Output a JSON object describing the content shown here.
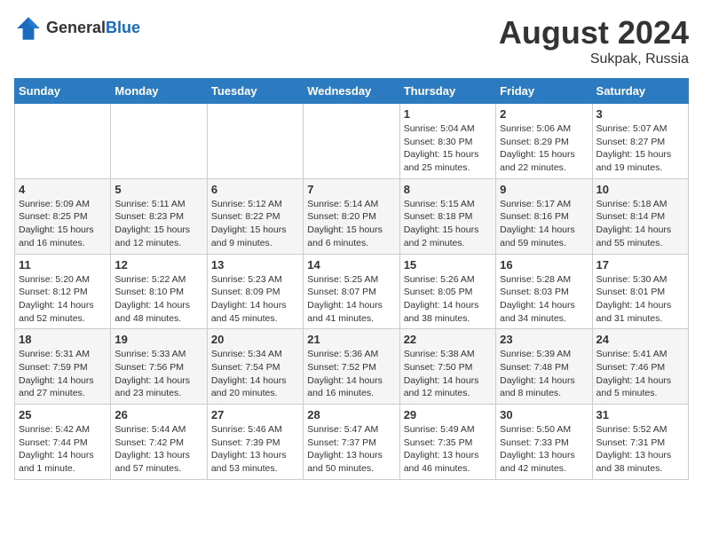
{
  "header": {
    "logo_general": "General",
    "logo_blue": "Blue",
    "month_year": "August 2024",
    "location": "Sukpak, Russia"
  },
  "weekdays": [
    "Sunday",
    "Monday",
    "Tuesday",
    "Wednesday",
    "Thursday",
    "Friday",
    "Saturday"
  ],
  "weeks": [
    [
      {
        "day": "",
        "info": ""
      },
      {
        "day": "",
        "info": ""
      },
      {
        "day": "",
        "info": ""
      },
      {
        "day": "",
        "info": ""
      },
      {
        "day": "1",
        "info": "Sunrise: 5:04 AM\nSunset: 8:30 PM\nDaylight: 15 hours\nand 25 minutes."
      },
      {
        "day": "2",
        "info": "Sunrise: 5:06 AM\nSunset: 8:29 PM\nDaylight: 15 hours\nand 22 minutes."
      },
      {
        "day": "3",
        "info": "Sunrise: 5:07 AM\nSunset: 8:27 PM\nDaylight: 15 hours\nand 19 minutes."
      }
    ],
    [
      {
        "day": "4",
        "info": "Sunrise: 5:09 AM\nSunset: 8:25 PM\nDaylight: 15 hours\nand 16 minutes."
      },
      {
        "day": "5",
        "info": "Sunrise: 5:11 AM\nSunset: 8:23 PM\nDaylight: 15 hours\nand 12 minutes."
      },
      {
        "day": "6",
        "info": "Sunrise: 5:12 AM\nSunset: 8:22 PM\nDaylight: 15 hours\nand 9 minutes."
      },
      {
        "day": "7",
        "info": "Sunrise: 5:14 AM\nSunset: 8:20 PM\nDaylight: 15 hours\nand 6 minutes."
      },
      {
        "day": "8",
        "info": "Sunrise: 5:15 AM\nSunset: 8:18 PM\nDaylight: 15 hours\nand 2 minutes."
      },
      {
        "day": "9",
        "info": "Sunrise: 5:17 AM\nSunset: 8:16 PM\nDaylight: 14 hours\nand 59 minutes."
      },
      {
        "day": "10",
        "info": "Sunrise: 5:18 AM\nSunset: 8:14 PM\nDaylight: 14 hours\nand 55 minutes."
      }
    ],
    [
      {
        "day": "11",
        "info": "Sunrise: 5:20 AM\nSunset: 8:12 PM\nDaylight: 14 hours\nand 52 minutes."
      },
      {
        "day": "12",
        "info": "Sunrise: 5:22 AM\nSunset: 8:10 PM\nDaylight: 14 hours\nand 48 minutes."
      },
      {
        "day": "13",
        "info": "Sunrise: 5:23 AM\nSunset: 8:09 PM\nDaylight: 14 hours\nand 45 minutes."
      },
      {
        "day": "14",
        "info": "Sunrise: 5:25 AM\nSunset: 8:07 PM\nDaylight: 14 hours\nand 41 minutes."
      },
      {
        "day": "15",
        "info": "Sunrise: 5:26 AM\nSunset: 8:05 PM\nDaylight: 14 hours\nand 38 minutes."
      },
      {
        "day": "16",
        "info": "Sunrise: 5:28 AM\nSunset: 8:03 PM\nDaylight: 14 hours\nand 34 minutes."
      },
      {
        "day": "17",
        "info": "Sunrise: 5:30 AM\nSunset: 8:01 PM\nDaylight: 14 hours\nand 31 minutes."
      }
    ],
    [
      {
        "day": "18",
        "info": "Sunrise: 5:31 AM\nSunset: 7:59 PM\nDaylight: 14 hours\nand 27 minutes."
      },
      {
        "day": "19",
        "info": "Sunrise: 5:33 AM\nSunset: 7:56 PM\nDaylight: 14 hours\nand 23 minutes."
      },
      {
        "day": "20",
        "info": "Sunrise: 5:34 AM\nSunset: 7:54 PM\nDaylight: 14 hours\nand 20 minutes."
      },
      {
        "day": "21",
        "info": "Sunrise: 5:36 AM\nSunset: 7:52 PM\nDaylight: 14 hours\nand 16 minutes."
      },
      {
        "day": "22",
        "info": "Sunrise: 5:38 AM\nSunset: 7:50 PM\nDaylight: 14 hours\nand 12 minutes."
      },
      {
        "day": "23",
        "info": "Sunrise: 5:39 AM\nSunset: 7:48 PM\nDaylight: 14 hours\nand 8 minutes."
      },
      {
        "day": "24",
        "info": "Sunrise: 5:41 AM\nSunset: 7:46 PM\nDaylight: 14 hours\nand 5 minutes."
      }
    ],
    [
      {
        "day": "25",
        "info": "Sunrise: 5:42 AM\nSunset: 7:44 PM\nDaylight: 14 hours\nand 1 minute."
      },
      {
        "day": "26",
        "info": "Sunrise: 5:44 AM\nSunset: 7:42 PM\nDaylight: 13 hours\nand 57 minutes."
      },
      {
        "day": "27",
        "info": "Sunrise: 5:46 AM\nSunset: 7:39 PM\nDaylight: 13 hours\nand 53 minutes."
      },
      {
        "day": "28",
        "info": "Sunrise: 5:47 AM\nSunset: 7:37 PM\nDaylight: 13 hours\nand 50 minutes."
      },
      {
        "day": "29",
        "info": "Sunrise: 5:49 AM\nSunset: 7:35 PM\nDaylight: 13 hours\nand 46 minutes."
      },
      {
        "day": "30",
        "info": "Sunrise: 5:50 AM\nSunset: 7:33 PM\nDaylight: 13 hours\nand 42 minutes."
      },
      {
        "day": "31",
        "info": "Sunrise: 5:52 AM\nSunset: 7:31 PM\nDaylight: 13 hours\nand 38 minutes."
      }
    ]
  ]
}
